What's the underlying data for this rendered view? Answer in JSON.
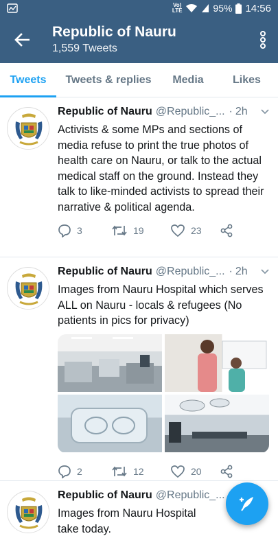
{
  "status_bar": {
    "volte": "Vo)\nLTE",
    "battery": "95%",
    "time": "14:56",
    "icons": [
      "notification-icon",
      "volte-icon",
      "wifi-icon",
      "signal-icon",
      "battery-icon"
    ]
  },
  "header": {
    "title": "Republic of Nauru",
    "subtitle": "1,559 Tweets",
    "back_icon": "arrow-left-icon",
    "more_icon": "more-vertical-icon"
  },
  "tabs": [
    {
      "label": "Tweets",
      "active": true
    },
    {
      "label": "Tweets & replies",
      "active": false
    },
    {
      "label": "Media",
      "active": false
    },
    {
      "label": "Likes",
      "active": false
    }
  ],
  "tweets": [
    {
      "name": "Republic of Nauru",
      "handle": "@Republic_...",
      "dot": "·",
      "time": "2h",
      "text": "Activists & some MPs and sections of media refuse to print the true photos of health care on Nauru, or talk to the actual medical staff on the ground. Instead they talk to like-minded activists to spread their narrative & political agenda.",
      "replies": "3",
      "retweets": "19",
      "likes": "23"
    },
    {
      "name": "Republic of Nauru",
      "handle": "@Republic_...",
      "dot": "·",
      "time": "2h",
      "text": "Images from Nauru Hospital which serves ALL on Nauru - locals & refugees (No patients in pics for privacy)",
      "replies": "2",
      "retweets": "12",
      "likes": "20"
    },
    {
      "name": "Republic of Nauru",
      "handle": "@Republic_...",
      "text": "Images from Nauru Hospital take today."
    }
  ],
  "colors": {
    "header_bg": "#3a5f82",
    "accent": "#1da1f2",
    "secondary_text": "#657786"
  },
  "fab_icon": "compose-tweet-icon"
}
